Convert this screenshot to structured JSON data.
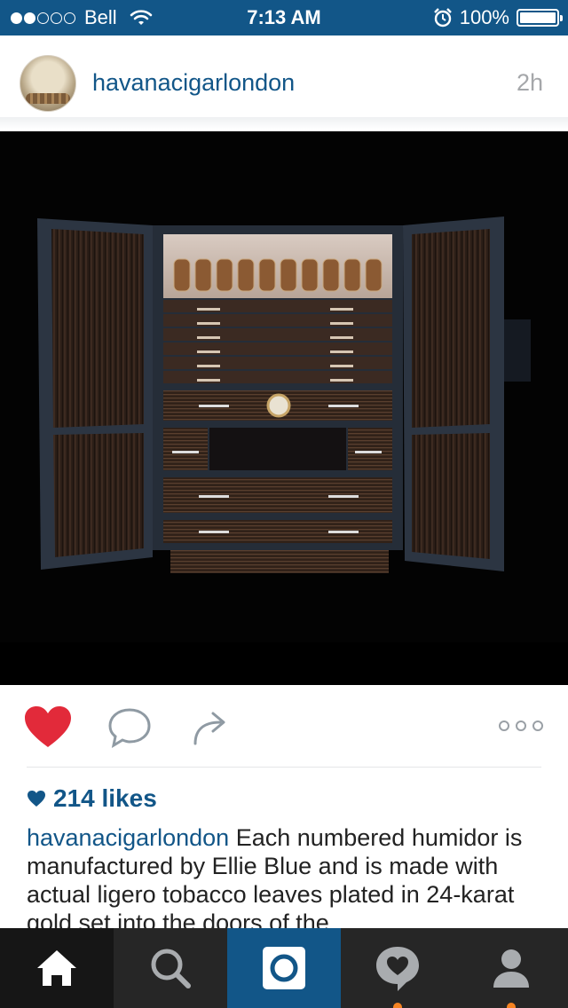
{
  "status_bar": {
    "carrier": "Bell",
    "time": "7:13 AM",
    "battery": "100%",
    "battery_level": 1.0,
    "signal_bars_filled": 2,
    "signal_bars_total": 5
  },
  "post": {
    "username": "havanacigarlondon",
    "time_ago": "2h",
    "likes": "214 likes",
    "caption_user": "havanacigarlondon",
    "caption_text": "Each numbered humidor is manufactured by Ellie Blue and is made with actual ligero tobacco leaves plated in 24-karat gold set into the doors of the"
  },
  "actions": {
    "liked": true,
    "heart_color": "#e22a3a"
  },
  "tabbar": {
    "tabs": [
      "home",
      "search",
      "camera",
      "activity",
      "profile"
    ],
    "active": "home"
  },
  "colors": {
    "brand_blue": "#125688",
    "tab_bg": "#262626",
    "notification": "#f58322"
  },
  "icons": [
    "wifi-icon",
    "alarm-icon",
    "battery-icon",
    "heart-icon",
    "comment-icon",
    "share-icon",
    "more-icon",
    "home-icon",
    "search-icon",
    "camera-icon",
    "activity-icon",
    "profile-icon"
  ]
}
